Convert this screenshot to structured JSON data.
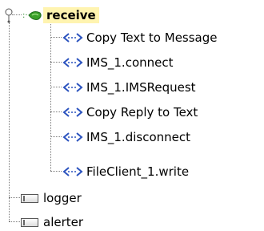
{
  "tree": {
    "root": {
      "label": "receive",
      "expanded": true
    },
    "operations": [
      {
        "label": "Copy Text to Message"
      },
      {
        "label": "IMS_1.connect"
      },
      {
        "label": "IMS_1.IMSRequest"
      },
      {
        "label": "Copy Reply to Text"
      },
      {
        "label": "IMS_1.disconnect"
      },
      {
        "label": "FileClient_1.write"
      }
    ],
    "siblings": [
      {
        "label": "logger"
      },
      {
        "label": "alerter"
      }
    ]
  },
  "colors": {
    "selection_bg": "#fff4b0",
    "op_icon_blue": "#2a52be",
    "receive_icon_green": "#3aa02a"
  },
  "icons": {
    "expand_handle": "expand-handle-icon",
    "receive": "receive-icon",
    "operation": "operation-arrows-icon",
    "component": "component-box-icon"
  }
}
